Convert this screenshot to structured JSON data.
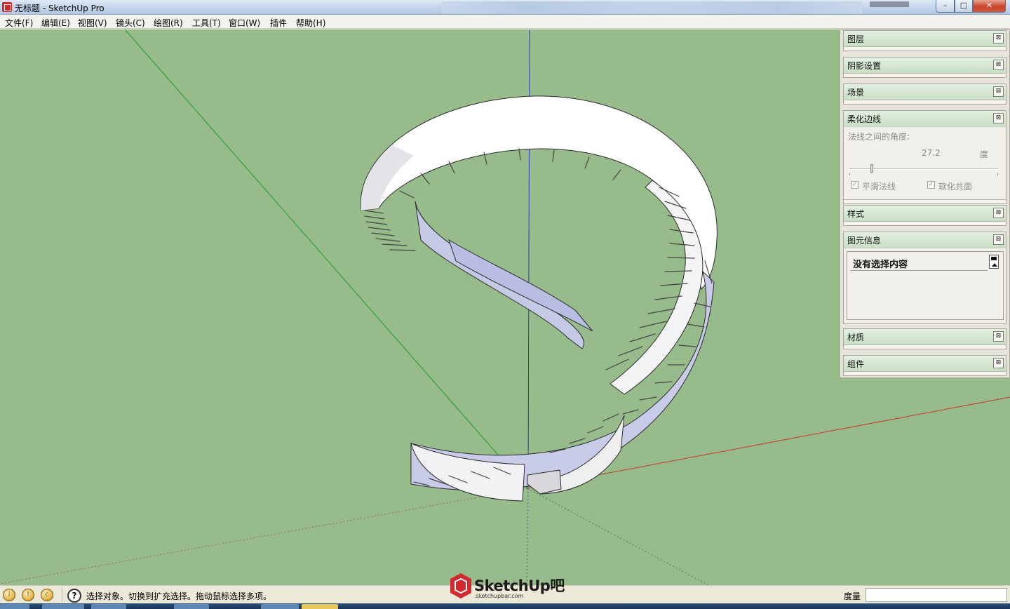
{
  "window": {
    "title": "无标题 - SketchUp Pro",
    "controls": {
      "minimize": "–",
      "maximize": "□",
      "close": "✕"
    }
  },
  "menu": {
    "items": [
      "文件(F)",
      "编辑(E)",
      "视图(V)",
      "镜头(C)",
      "绘图(R)",
      "工具(T)",
      "窗口(W)",
      "插件",
      "帮助(H)"
    ]
  },
  "colors": {
    "viewport_bg": "#98bb8c",
    "axis_red": "#c43a2e",
    "axis_green": "#1f9a2a",
    "axis_blue": "#2b39b5",
    "stair_face": "#c8cce8",
    "stair_edge": "#ffffff"
  },
  "tray": {
    "panels": {
      "layers": "图层",
      "shadows": "阴影设置",
      "scenes": "场景",
      "soften": "柔化边线",
      "styles": "样式",
      "entity_info": "图元信息",
      "materials": "材质",
      "components": "组件"
    },
    "close_glyph": "⊠",
    "soften": {
      "angle_label": "法线之间的角度:",
      "angle_value": "27.2",
      "angle_unit": "度",
      "angle_fraction": 0.15,
      "smooth_normals_label": "平滑法线",
      "smooth_normals_checked": true,
      "soften_coplanar_label": "软化共面",
      "soften_coplanar_checked": true,
      "check_glyph": "✓"
    },
    "entity_info": {
      "selection_text": "没有选择内容"
    }
  },
  "statusbar": {
    "icons": [
      "info-icon",
      "geo-location-icon",
      "credits-icon"
    ],
    "help_glyph": "?",
    "hint": "选择对象。切换到扩充选择。拖动鼠标选择多项。",
    "measure_label": "度量",
    "measure_value": ""
  },
  "logo": {
    "text": "SketchUp吧",
    "url": "sketchupbar.com"
  }
}
